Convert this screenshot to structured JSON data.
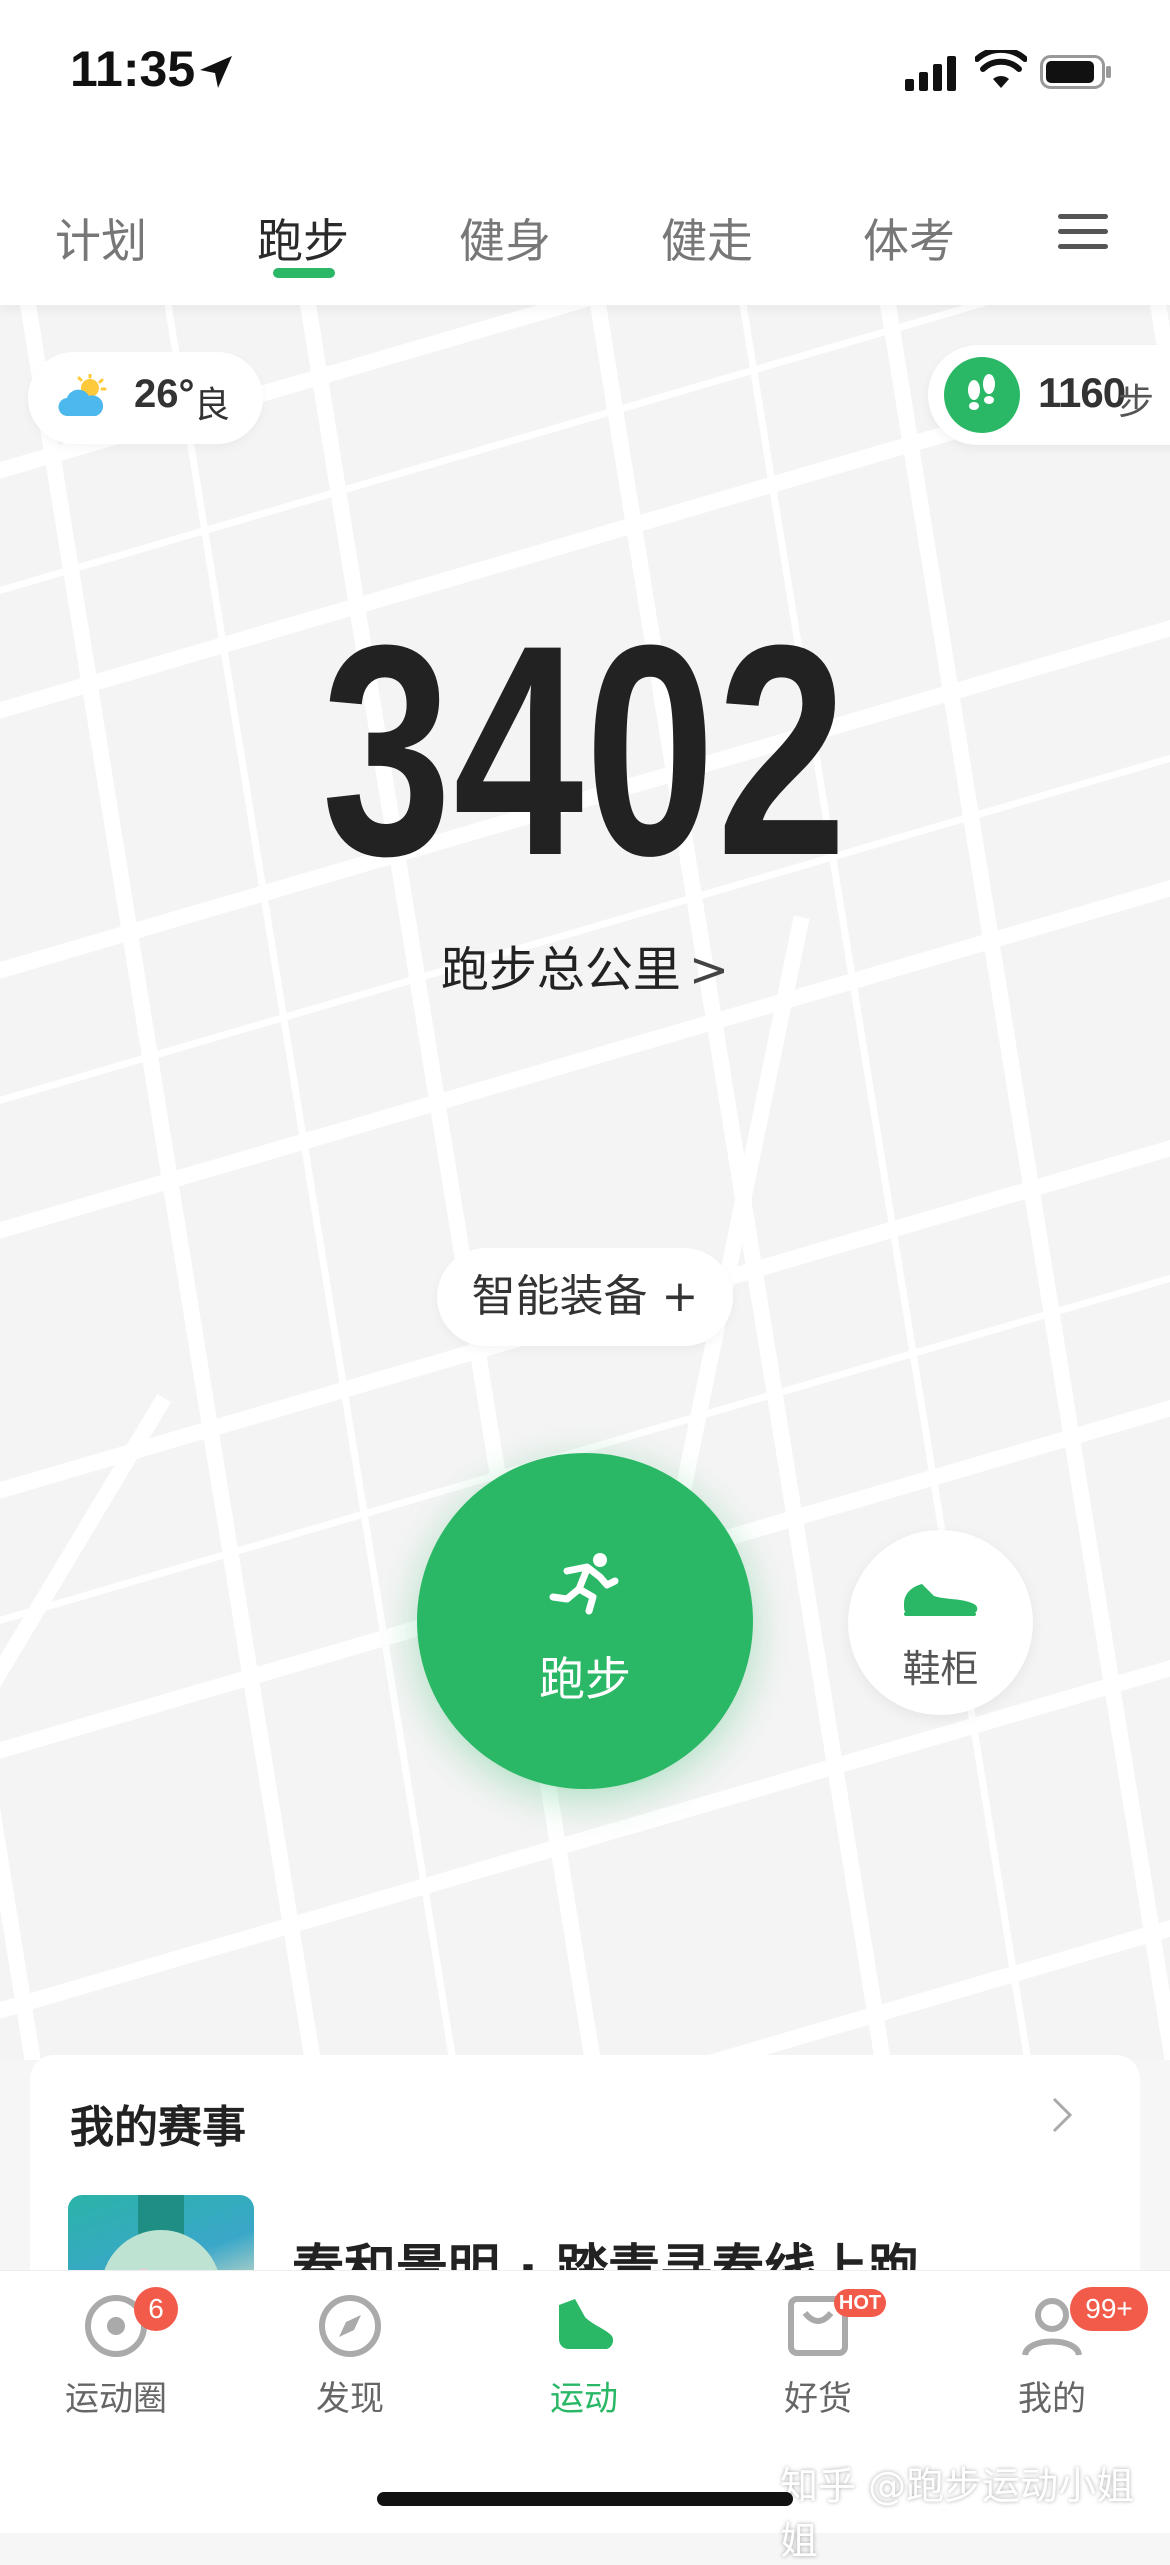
{
  "status_bar": {
    "time": "11:35"
  },
  "tabs": [
    {
      "label": "计划"
    },
    {
      "label": "跑步"
    },
    {
      "label": "健身"
    },
    {
      "label": "健走"
    },
    {
      "label": "体考"
    }
  ],
  "active_tab": "跑步",
  "weather": {
    "temp": "26°",
    "aqi": "良"
  },
  "steps": {
    "count": "1160",
    "unit": "步"
  },
  "total": {
    "value": "3402",
    "label": "跑步总公里",
    "chevron": ">"
  },
  "smart_gear": {
    "label": "智能装备 +"
  },
  "run_button": {
    "label": "跑步"
  },
  "shoe_cabinet": {
    "label": "鞋柜"
  },
  "events": {
    "title": "我的赛事",
    "item_name": "春和景明 · 踏青寻春线上跑"
  },
  "bottom_nav": [
    {
      "label": "运动圈",
      "badge": "6"
    },
    {
      "label": "发现"
    },
    {
      "label": "运动",
      "active": true
    },
    {
      "label": "好货",
      "badge": "HOT"
    },
    {
      "label": "我的",
      "badge": "99+"
    }
  ],
  "watermark": "知乎 @跑步运动小姐姐",
  "colors": {
    "accent": "#2bb866",
    "badge": "#f25a4a"
  }
}
